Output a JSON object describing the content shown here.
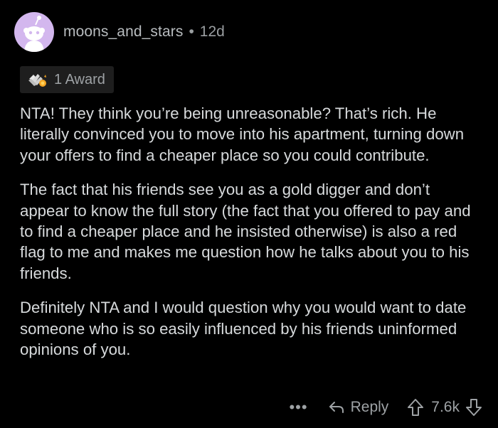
{
  "comment": {
    "author": "moons_and_stars",
    "separator": "•",
    "age": "12d",
    "award_label": "1 Award",
    "paragraphs": [
      "NTA! They think you’re being unreasonable? That’s rich. He literally convinced you to move into his apartment, turning down your offers to find a cheaper place so you could contribute.",
      "The fact that his friends see you as a gold digger and don’t appear to know the full story (the fact that you offered to pay and to find a cheaper place and he insisted otherwise) is also a red flag to me and makes me question how he talks about you to his friends.",
      "Definitely NTA and I would question why you would want to date someone who is so easily influenced by his friends uninformed opinions of you."
    ]
  },
  "actions": {
    "more": "•••",
    "reply_label": "Reply",
    "score": "7.6k"
  },
  "icons": {
    "avatar": "snoo-avatar-icon",
    "award": "wholesome-award-icon",
    "reply": "reply-arrow-icon",
    "upvote": "upvote-arrow-icon",
    "downvote": "downvote-arrow-icon"
  },
  "colors": {
    "background": "#000000",
    "avatar_bg": "#d3b7ee",
    "text": "#d7dadc",
    "meta": "#9ea2a5",
    "award_bg": "#1e1e1e"
  }
}
